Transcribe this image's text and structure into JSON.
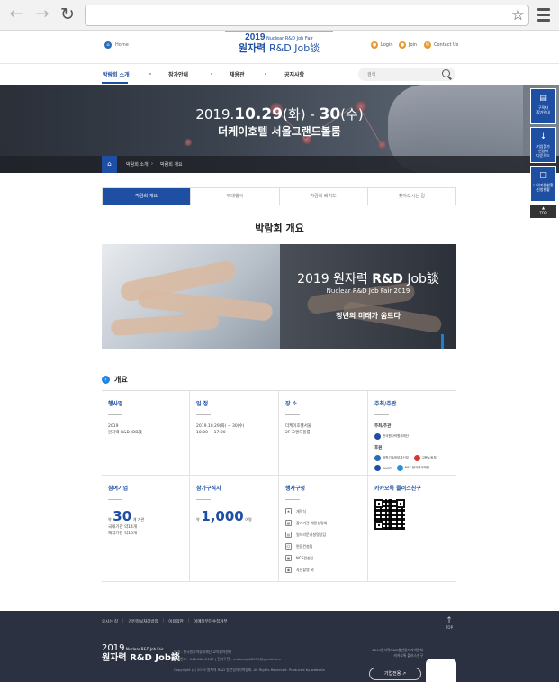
{
  "browser": {
    "back_icon": "arrow-left",
    "forward_icon": "arrow-right",
    "reload_icon": "reload",
    "url": "",
    "star_icon": "star",
    "menu_icon": "hamburger"
  },
  "header": {
    "home_label": "Home",
    "logo": {
      "year": "2019",
      "sub": "Nuclear R&D Job Fair",
      "title_kr": "원자력",
      "title_en": "R&D Job談"
    },
    "login_label": "Login",
    "join_label": "Join",
    "contact_label": "Contact Us"
  },
  "gnb": {
    "items": [
      "박람회 소개",
      "참가안내",
      "채용관",
      "공지사항"
    ],
    "search_placeholder": "검색"
  },
  "hero": {
    "date_prefix": "2019.",
    "date_main": "10.29",
    "date_mid": "(화) - ",
    "date_end": "30",
    "date_suffix": "(수)",
    "venue": "더케이호텔 서울그랜드볼룸",
    "breadcrumb": [
      "박람회 소개",
      "박람회 개요"
    ]
  },
  "quick_menu": {
    "items": [
      "구직자\n참가안내",
      "기업참가\n신청서\n다운로드",
      "나의지원현황\n신청현황"
    ],
    "top_label": "TOP"
  },
  "tabs": [
    "박람회 개요",
    "부대행사",
    "박람회 배치도",
    "찾아오시는 길"
  ],
  "page_title": "박람회 개요",
  "banner": {
    "title_year": "2019 원자력 ",
    "title_brand": "R&D",
    "title_tail": " Job談",
    "subtitle": "Nuclear R&D Job Fair 2019",
    "slogan": "청년의 미래가 움트다"
  },
  "overview": {
    "heading": "개요",
    "event_name": {
      "title": "행사명",
      "text": "2019\n원자력 R&D JOB談"
    },
    "schedule": {
      "title": "일 정",
      "text": "2019.10.29(화) ~ 30(수)\n10:00 ~ 17:00"
    },
    "location": {
      "title": "장 소",
      "text": "더케이호텔서울\n2F 그랜드볼룸"
    },
    "host": {
      "title": "주최/주관",
      "host_label": "주최/주관",
      "host_org": "한국원자력협회재단",
      "support_label": "후원",
      "support_orgs": [
        "과학기술정보통신부",
        "고용노동부",
        "KAIST",
        "NRF 한국연구재단"
      ]
    },
    "companies": {
      "title": "참여기업",
      "prefix": "약",
      "number": "30",
      "unit": "개 기관",
      "detail": "국내기관 약14개\n해외기관 약16개"
    },
    "job_seekers": {
      "title": "참가구직자",
      "prefix": "약",
      "number": "1,000",
      "unit": "여명"
    },
    "program": {
      "title": "행사구성",
      "items": [
        "개막식",
        "참가기관 채용설명회",
        "일자리문서설명상담",
        "면접컨설팅",
        "NCS컨설팅",
        "사진촬영 외"
      ]
    },
    "kakao": {
      "title": "카카오톡 플러스친구"
    }
  },
  "footer": {
    "links": [
      "오시는 길",
      "개인정보처리방침",
      "이용약관",
      "이메일무단수집거부"
    ],
    "top_label": "TOP",
    "logo": {
      "year": "2019",
      "sub": "Nuclear R&D Job Fair",
      "title": "원자력 R&D Job談"
    },
    "info_line1": "운영 : 한국원자력협회재단 교육협력센터",
    "info_line2": "전화번호 : 042-866-0167   |   전자우편 : nuclearjob2019@gmail.com",
    "copyright": "Copyright (c) 2019 원자력 R&D 청년일자리박람회. All Rights Reserved. Produced by webaria",
    "right_text": "2019원자력R&D청년일자리박람회\n카카오톡 플러스친구",
    "company_button": "기업전용"
  }
}
